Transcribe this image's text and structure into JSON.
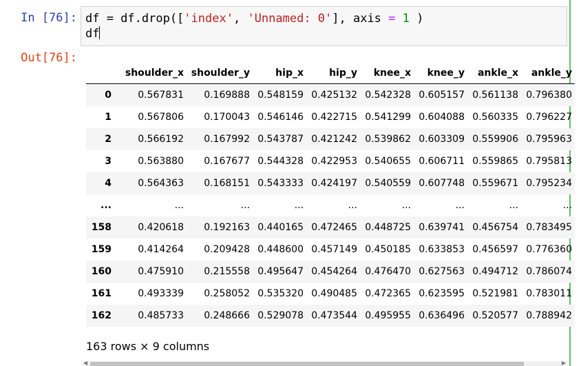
{
  "input_prompt": "In [76]:",
  "output_prompt": "Out[76]:",
  "code": {
    "line1": {
      "p1": "df = df.drop([",
      "s1": "'index'",
      "p2": ", ",
      "s2": "'Unnamed: 0'",
      "p3": "], axis ",
      "eq": "=",
      "sp": " ",
      "num": "1",
      "p4": " )"
    },
    "line2": "df"
  },
  "table": {
    "columns": [
      "",
      "shoulder_x",
      "shoulder_y",
      "hip_x",
      "hip_y",
      "knee_x",
      "knee_y",
      "ankle_x",
      "ankle_y"
    ],
    "rows": [
      [
        "0",
        "0.567831",
        "0.169888",
        "0.548159",
        "0.425132",
        "0.542328",
        "0.605157",
        "0.561138",
        "0.796380"
      ],
      [
        "1",
        "0.567806",
        "0.170043",
        "0.546146",
        "0.422715",
        "0.541299",
        "0.604088",
        "0.560335",
        "0.796227"
      ],
      [
        "2",
        "0.566192",
        "0.167992",
        "0.543787",
        "0.421242",
        "0.539862",
        "0.603309",
        "0.559906",
        "0.795963"
      ],
      [
        "3",
        "0.563880",
        "0.167677",
        "0.544328",
        "0.422953",
        "0.540655",
        "0.606711",
        "0.559865",
        "0.795813"
      ],
      [
        "4",
        "0.564363",
        "0.168151",
        "0.543333",
        "0.424197",
        "0.540559",
        "0.607748",
        "0.559671",
        "0.795234"
      ],
      [
        "...",
        "...",
        "...",
        "...",
        "...",
        "...",
        "...",
        "...",
        "..."
      ],
      [
        "158",
        "0.420618",
        "0.192163",
        "0.440165",
        "0.472465",
        "0.448725",
        "0.639741",
        "0.456754",
        "0.783495"
      ],
      [
        "159",
        "0.414264",
        "0.209428",
        "0.448600",
        "0.457149",
        "0.450185",
        "0.633853",
        "0.456597",
        "0.776360"
      ],
      [
        "160",
        "0.475910",
        "0.215558",
        "0.495647",
        "0.454264",
        "0.476470",
        "0.627563",
        "0.494712",
        "0.786074"
      ],
      [
        "161",
        "0.493339",
        "0.258052",
        "0.535320",
        "0.490485",
        "0.472365",
        "0.623595",
        "0.521981",
        "0.783011"
      ],
      [
        "162",
        "0.485733",
        "0.248666",
        "0.529078",
        "0.473544",
        "0.495955",
        "0.636496",
        "0.520577",
        "0.788942"
      ]
    ]
  },
  "shape_note": "163 rows × 9 columns",
  "colors": {
    "in_prompt": "#303f9f",
    "out_prompt": "#d84315",
    "string": "#ba2121",
    "operator": "#aa22ff",
    "number": "#008800",
    "cell_selected_border": "#66bb6a"
  }
}
